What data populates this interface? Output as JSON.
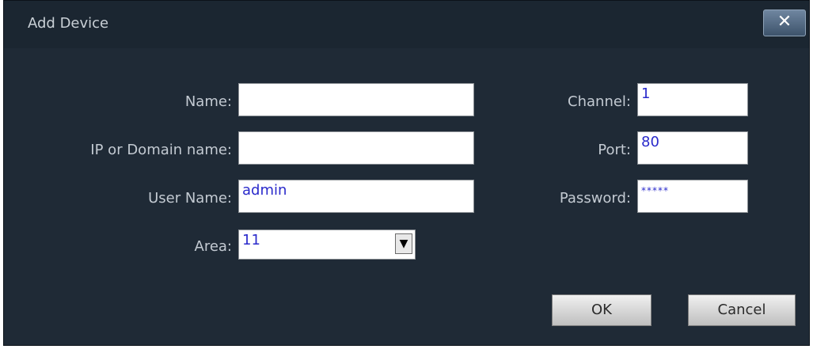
{
  "dialog": {
    "title": "Add Device",
    "close_symbol": "✕"
  },
  "form": {
    "name_label": "Name:",
    "name_value": "",
    "ip_label": "IP or Domain name:",
    "ip_value": "",
    "username_label": "User Name:",
    "username_value": "admin",
    "area_label": "Area:",
    "area_value": "11",
    "area_arrow": "▼",
    "channel_label": "Channel:",
    "channel_value": "1",
    "port_label": "Port:",
    "port_value": "80",
    "password_label": "Password:",
    "password_value": "*****"
  },
  "buttons": {
    "ok_label": "OK",
    "cancel_label": "Cancel"
  },
  "colors": {
    "dialog_bg": "#1f2a36",
    "label_text": "#c3cad2",
    "field_text": "#2a2acb"
  }
}
